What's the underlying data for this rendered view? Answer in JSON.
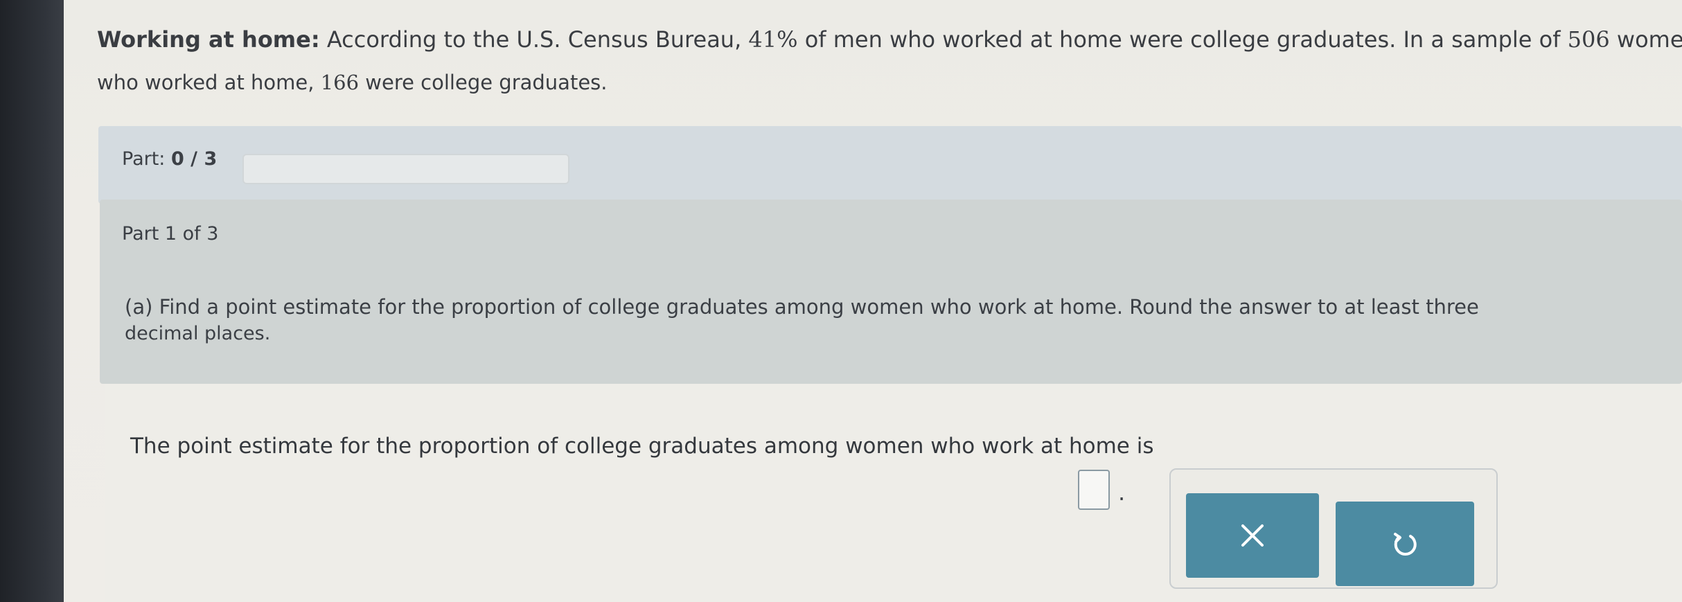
{
  "problem": {
    "bold_label": "Working at home:",
    "line1_text": " According to the U.S. Census Bureau, ",
    "men_percent": "41%",
    "line1_mid": " of men who worked at home were college graduates. In a sample of ",
    "sample_size": "506",
    "line1_end": " women",
    "line2_start": "who worked at home, ",
    "graduates": "166",
    "line2_end": " were college graduates."
  },
  "part_bar": {
    "label": "Part: ",
    "current": "0",
    "separator": " / ",
    "total": "3",
    "progress_fraction": 0
  },
  "part_header": {
    "label": "Part 1 of 3"
  },
  "question": {
    "line1": "(a) Find a point estimate for the proportion of college graduates among women who work at home. Round the answer to at least three",
    "line2": "decimal places."
  },
  "answer": {
    "sentence": "The point estimate for the proportion of college graduates among women who work at home is",
    "value": "",
    "period": "."
  },
  "buttons": {
    "clear_icon": "x-icon",
    "reset_icon": "undo-icon"
  },
  "colors": {
    "accent": "#4c8ba2",
    "part_bar_bg": "#d4dbe0",
    "part_header_bg": "#cfd4d3"
  }
}
